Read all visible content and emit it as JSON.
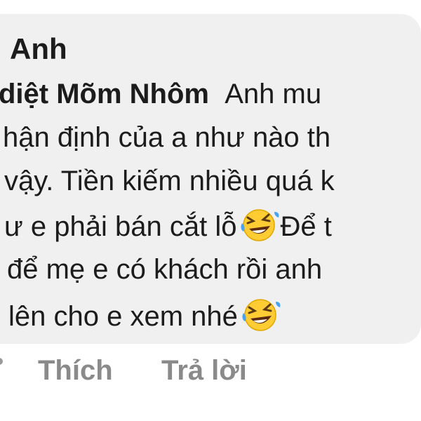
{
  "comment": {
    "author": "Anh",
    "mention": "diệt Mõm Nhôm",
    "lines": [
      "Anh mu",
      "hận định của a như nào th",
      "vậy. Tiền kiếm nhiều quá k",
      "ư e phải bán cắt lỗ",
      "Để t",
      "để mẹ e có khách rồi anh",
      "lên cho e xem nhé"
    ],
    "emoji": "rolling-on-floor-laughing-emoji"
  },
  "actions": {
    "like_label": "Thích",
    "reply_label": "Trả lời"
  },
  "colors": {
    "bubble_bg": "#f0f0f0",
    "text": "#1c1c1c",
    "action_text": "#8a8a8a"
  }
}
